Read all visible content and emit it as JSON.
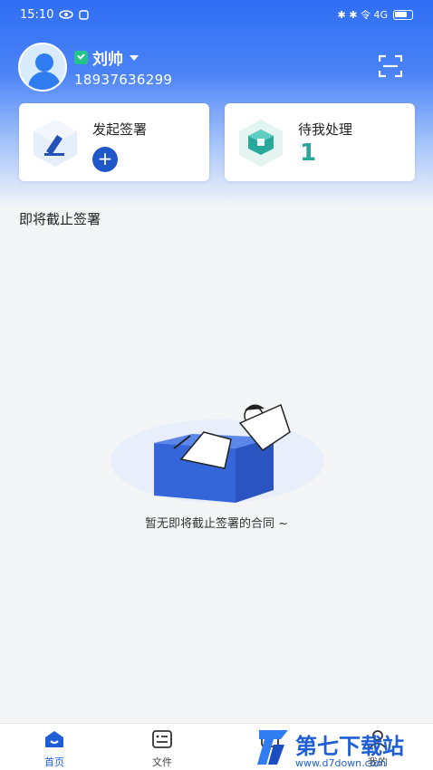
{
  "status_bar": {
    "time": "15:10",
    "right_indicators": "✱ ✱ 令 4G"
  },
  "user": {
    "name": "刘帅",
    "phone": "18937636299"
  },
  "cards": {
    "sign": {
      "title": "发起签署",
      "add_symbol": "+"
    },
    "todo": {
      "title": "待我处理",
      "count": "1"
    }
  },
  "section": {
    "title": "即将截止签署"
  },
  "empty": {
    "text": "暂无即将截止签署的合同 ~"
  },
  "tabs": [
    {
      "label": "首页",
      "icon": "home-icon",
      "active": true
    },
    {
      "label": "文件",
      "icon": "file-list-icon",
      "active": false
    },
    {
      "label": "",
      "icon": "tab-icon",
      "active": false
    },
    {
      "label": "我的",
      "icon": "profile-icon",
      "active": false
    }
  ],
  "watermark": {
    "text": "第七下载站",
    "url": "www.d7down.com"
  },
  "colors": {
    "primary": "#2f6ef5",
    "accent_green": "#2aa79b",
    "verify_green": "#23c48a"
  }
}
